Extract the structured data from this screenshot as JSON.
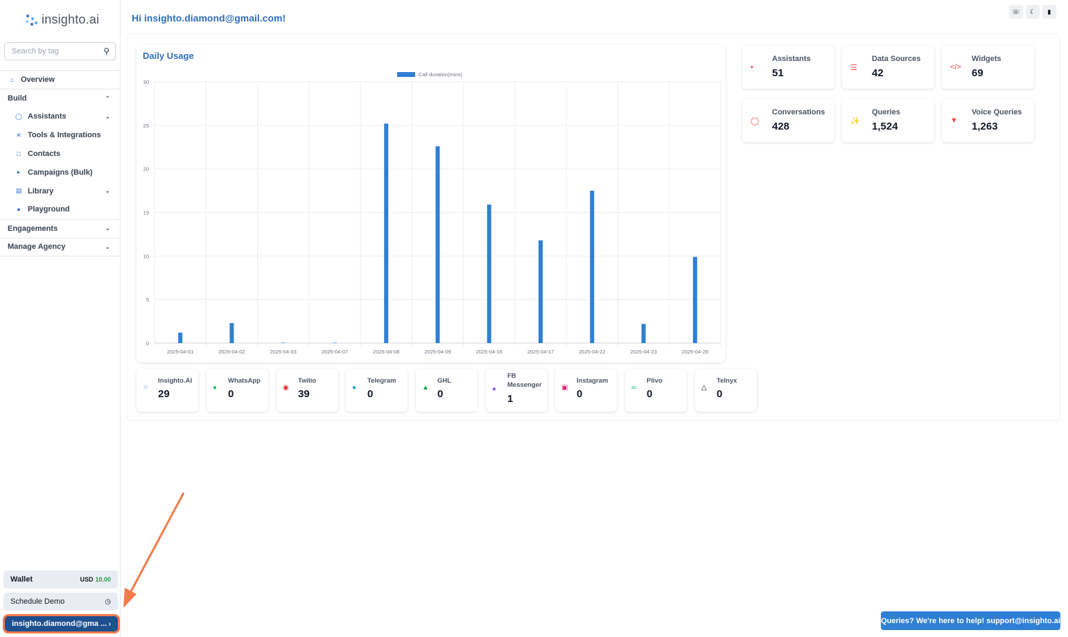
{
  "brand": {
    "name": "insighto.ai"
  },
  "search": {
    "placeholder": "Search by tag"
  },
  "nav": {
    "overview": "Overview",
    "build": "Build",
    "assistants": "Assistants",
    "tools": "Tools & Integrations",
    "contacts": "Contacts",
    "campaigns": "Campaigns (Bulk)",
    "library": "Library",
    "playground": "Playground",
    "engagements": "Engagements",
    "manage_agency": "Manage Agency"
  },
  "wallet": {
    "label": "Wallet",
    "currency": "USD",
    "amount": "10.00"
  },
  "schedule_demo": {
    "label": "Schedule Demo"
  },
  "user": {
    "label": "insighto.diamond@gma ..."
  },
  "greeting": "Hi insighto.diamond@gmail.com!",
  "chart_section": {
    "title": "Daily Usage"
  },
  "chart_data": {
    "type": "bar",
    "title": "",
    "series": [
      {
        "name": "Call duration(mins)",
        "values": [
          1.2,
          2.3,
          0,
          0,
          25.2,
          22.6,
          15.9,
          11.8,
          17.5,
          2.2,
          9.9
        ]
      }
    ],
    "categories": [
      "2025-04-01",
      "2025-04-02",
      "2025-04-03",
      "2025-04-07",
      "2025-04-08",
      "2025-04-09",
      "2025-04-16",
      "2025-04-17",
      "2025-04-22",
      "2025-04-23",
      "2025-04-29"
    ],
    "yticks": [
      "0",
      "5",
      "10",
      "15",
      "20",
      "25",
      "30"
    ],
    "ylim": [
      0,
      30
    ],
    "grid": true,
    "legend": "top-center",
    "color": "#2f7fd4"
  },
  "stats": [
    {
      "label": "Assistants",
      "value": "51",
      "icon": "assistant-icon"
    },
    {
      "label": "Data Sources",
      "value": "42",
      "icon": "database-icon"
    },
    {
      "label": "Widgets",
      "value": "69",
      "icon": "code-icon"
    },
    {
      "label": "Conversations",
      "value": "428",
      "icon": "chat-bubble-icon"
    },
    {
      "label": "Queries",
      "value": "1,524",
      "icon": "queries-icon"
    },
    {
      "label": "Voice Queries",
      "value": "1,263",
      "icon": "microphone-icon"
    }
  ],
  "channels": [
    {
      "label": "Insighto.AI",
      "value": "29",
      "icon": "insighto-icon"
    },
    {
      "label": "WhatsApp",
      "value": "0",
      "icon": "whatsapp-icon"
    },
    {
      "label": "Twilio",
      "value": "39",
      "icon": "twilio-icon"
    },
    {
      "label": "Telegram",
      "value": "0",
      "icon": "telegram-icon"
    },
    {
      "label": "GHL",
      "value": "0",
      "icon": "ghl-icon"
    },
    {
      "label": "FB Messenger",
      "value": "1",
      "icon": "messenger-icon"
    },
    {
      "label": "Instagram",
      "value": "0",
      "icon": "instagram-icon"
    },
    {
      "label": "Plivo",
      "value": "0",
      "icon": "plivo-icon"
    },
    {
      "label": "Telnyx",
      "value": "0",
      "icon": "telnyx-icon"
    }
  ],
  "support": {
    "label": "Queries? We're here to help! support@insighto.ai"
  }
}
